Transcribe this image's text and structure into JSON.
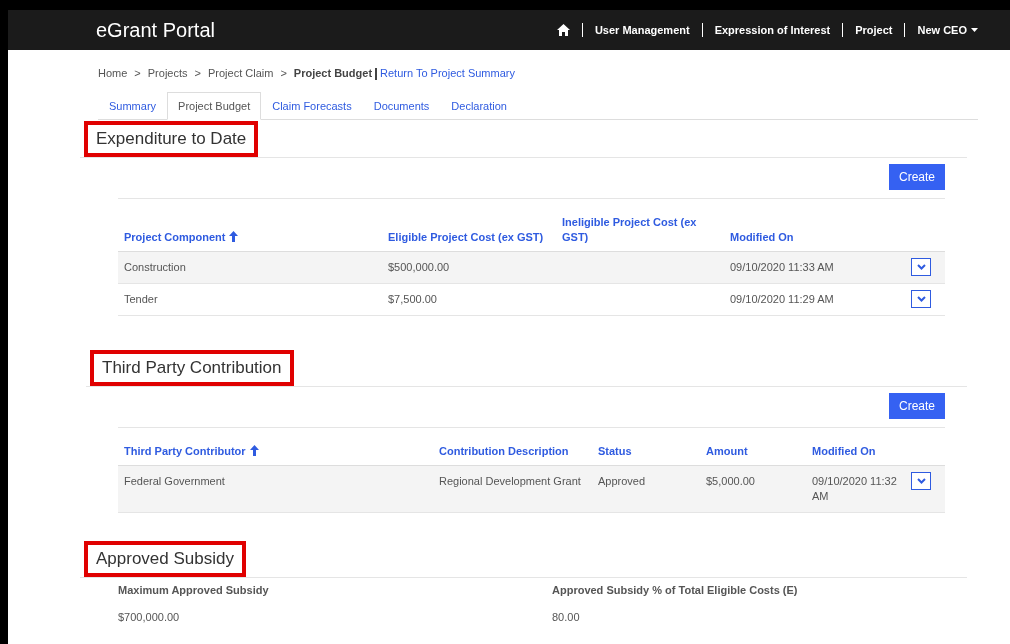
{
  "header": {
    "title": "eGrant Portal",
    "nav": [
      {
        "kind": "home"
      },
      {
        "kind": "link",
        "label": "User Management"
      },
      {
        "kind": "link",
        "label": "Expression of Interest"
      },
      {
        "kind": "link",
        "label": "Project"
      },
      {
        "kind": "menu",
        "label": "New CEO"
      }
    ]
  },
  "breadcrumb": {
    "items": [
      "Home",
      "Projects",
      "Project Claim"
    ],
    "separator": ">",
    "current": "Project Budget",
    "link": "Return To Project Summary"
  },
  "tabs": [
    {
      "label": "Summary",
      "selected": false
    },
    {
      "label": "Project Budget",
      "selected": true
    },
    {
      "label": "Claim Forecasts",
      "selected": false
    },
    {
      "label": "Documents",
      "selected": false
    },
    {
      "label": "Declaration",
      "selected": false
    }
  ],
  "expenditure": {
    "heading": "Expenditure to Date",
    "highlighted": true,
    "button": "Create",
    "columns": [
      {
        "label": "Project Component",
        "sorted": true
      },
      {
        "label": "Eligible Project Cost (ex GST)",
        "sorted": false
      },
      {
        "label": "Ineligible Project Cost (ex GST)",
        "sorted": false
      },
      {
        "label": "Modified On",
        "sorted": false
      }
    ],
    "rows": [
      [
        "Construction",
        "$500,000.00",
        "",
        "09/10/2020 11:33 AM"
      ],
      [
        "Tender",
        "$7,500.00",
        "",
        "09/10/2020 11:29 AM"
      ]
    ]
  },
  "contribution": {
    "heading": "Third Party Contribution",
    "highlighted": true,
    "button": "Create",
    "columns": [
      {
        "label": "Third Party Contributor",
        "sorted": true
      },
      {
        "label": "Contribution Description",
        "sorted": false
      },
      {
        "label": "Status",
        "sorted": false
      },
      {
        "label": "Amount",
        "sorted": false
      },
      {
        "label": "Modified On",
        "sorted": false
      }
    ],
    "rows": [
      [
        "Federal Government",
        "Regional Development Grant",
        "Approved",
        "$5,000.00",
        "09/10/2020 11:32 AM"
      ]
    ]
  },
  "subsidy": {
    "heading": "Approved Subsidy",
    "highlighted": true,
    "fields": [
      {
        "label": "Maximum Approved Subsidy",
        "value": "$700,000.00"
      },
      {
        "label": "Approved Subsidy % of Total Eligible Costs (E)",
        "value": "80.00"
      }
    ]
  }
}
